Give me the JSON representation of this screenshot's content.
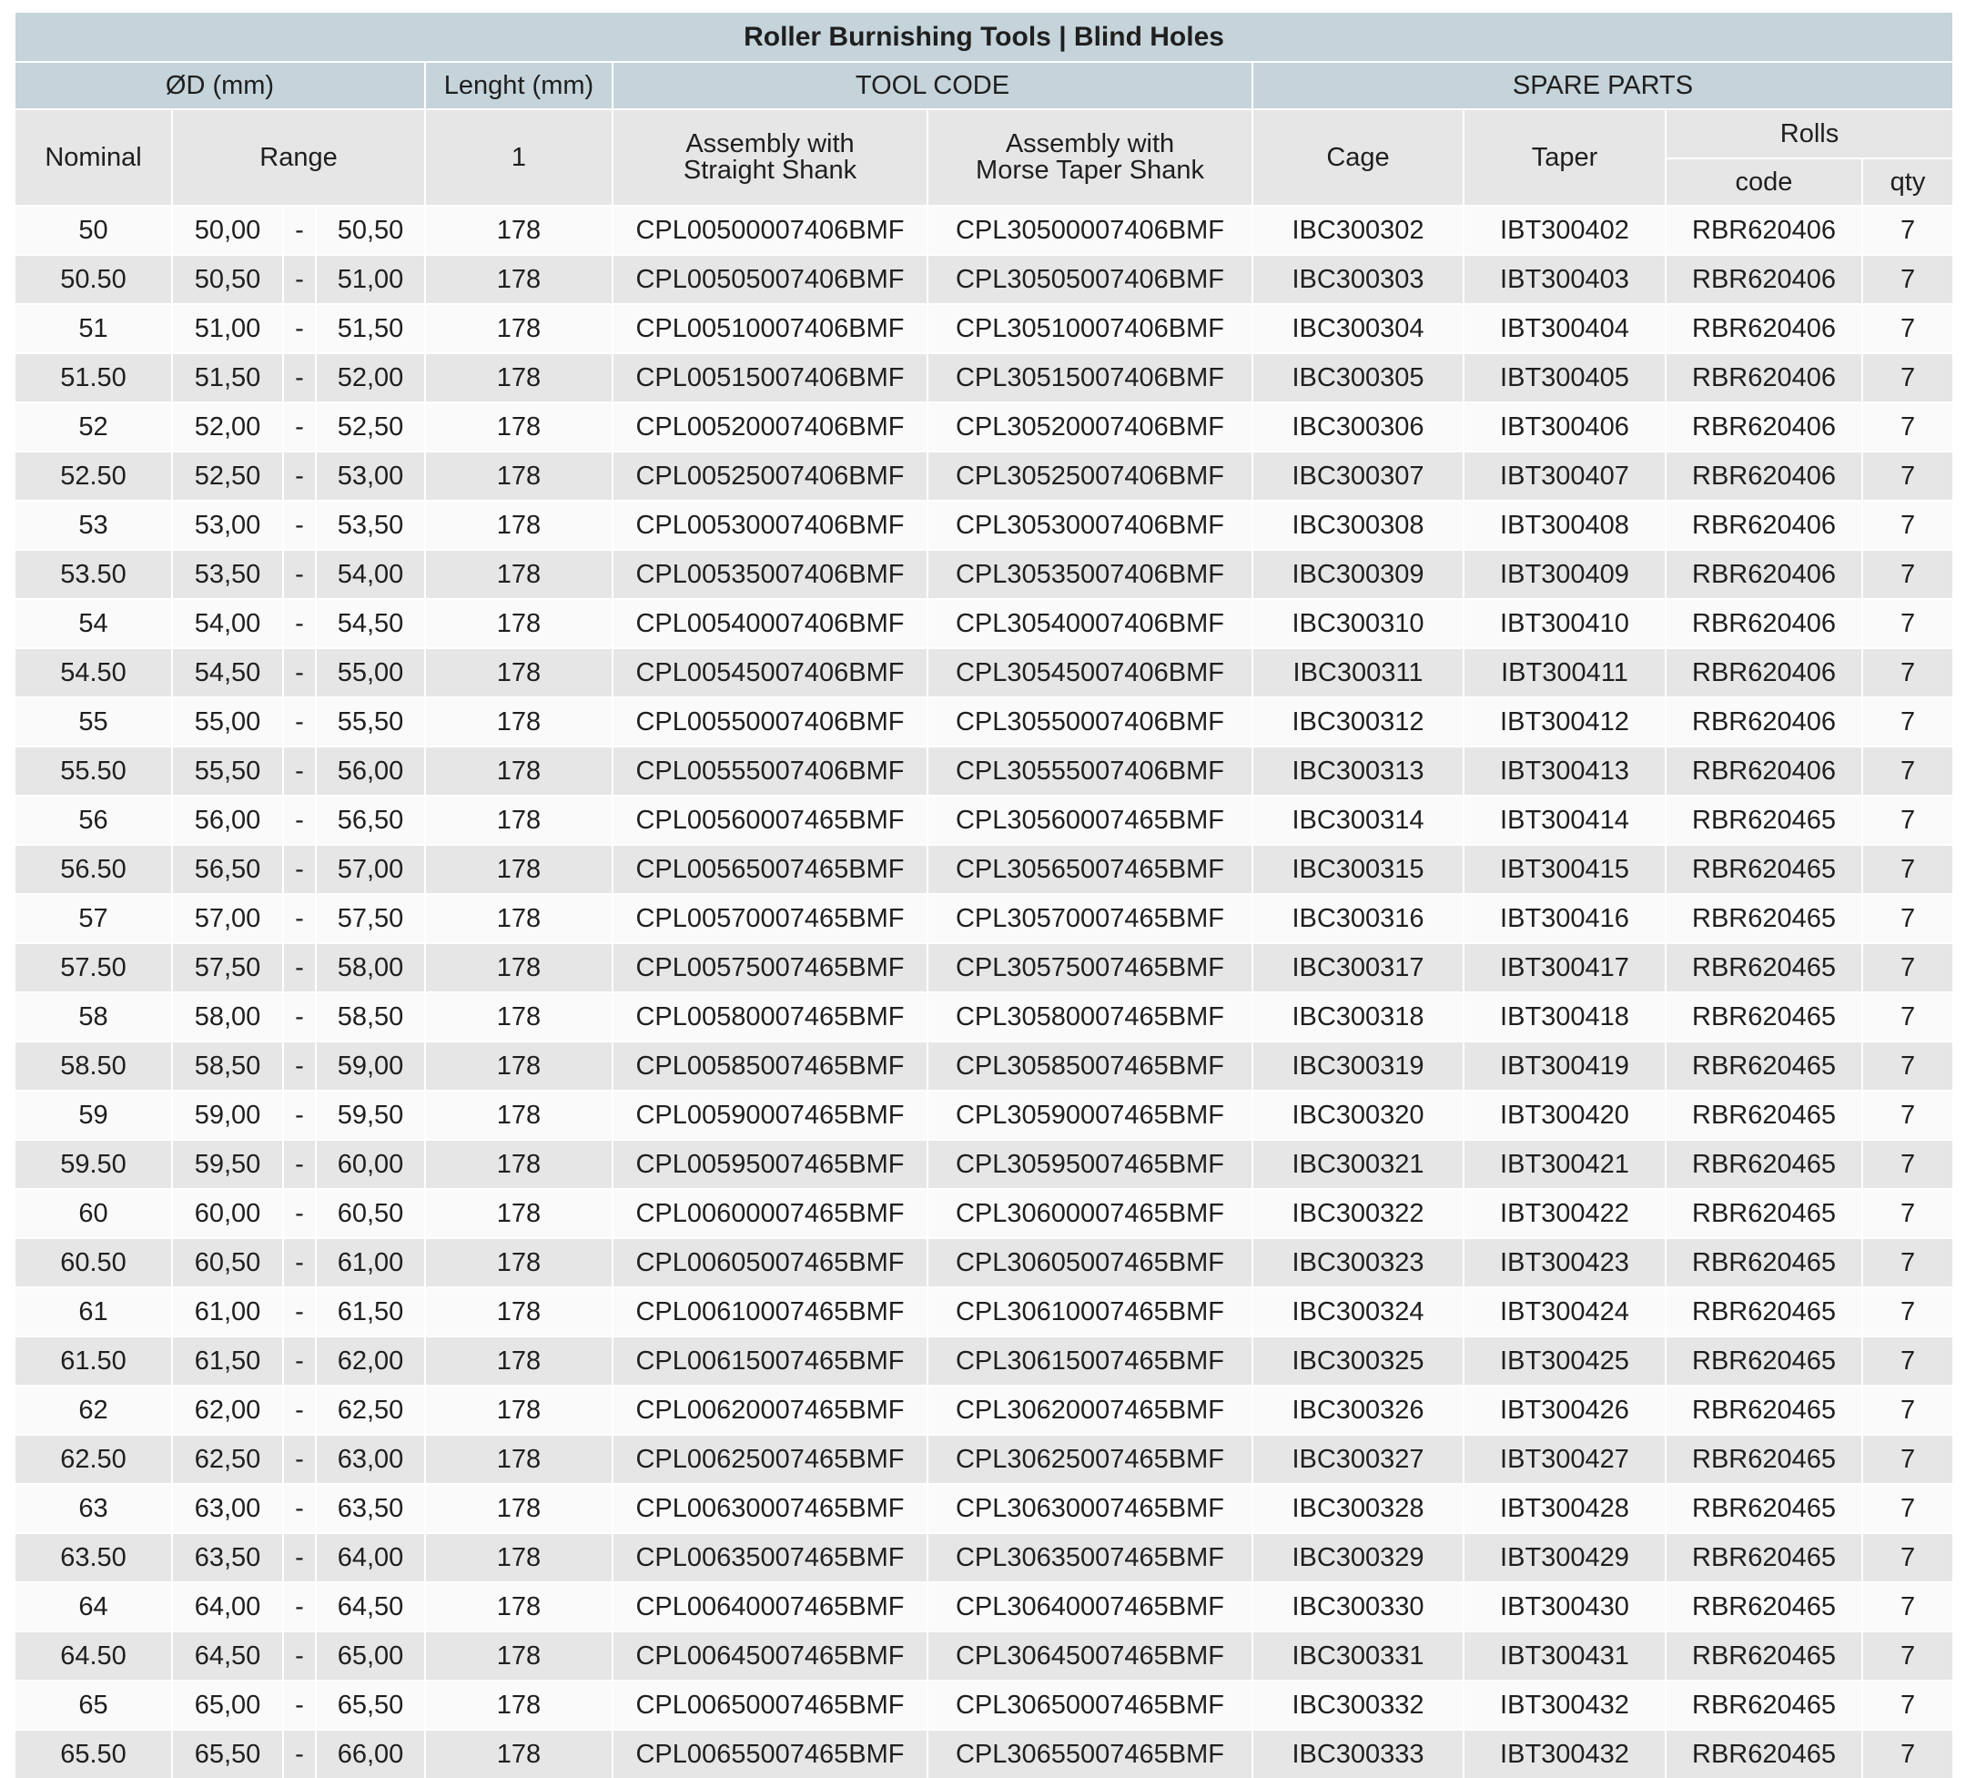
{
  "title": "Roller Burnishing Tools | Blind Holes",
  "groups": {
    "diameter": "ØD (mm)",
    "length": "Lenght (mm)",
    "tool_code": "TOOL CODE",
    "spare_parts": "SPARE PARTS"
  },
  "headers": {
    "nominal": "Nominal",
    "range": "Range",
    "length_sub": "1",
    "straight_1": "Assembly with",
    "straight_2": "Straight Shank",
    "morse_1": "Assembly with",
    "morse_2": "Morse Taper Shank",
    "cage": "Cage",
    "taper": "Taper",
    "rolls": "Rolls",
    "rolls_code": "code",
    "rolls_qty": "qty"
  },
  "range_separator": "-",
  "rows": [
    {
      "nominal": "50",
      "min": "50,00",
      "max": "50,50",
      "length": "178",
      "straight": "CPL00500007406BMF",
      "morse": "CPL30500007406BMF",
      "cage": "IBC300302",
      "taper": "IBT300402",
      "roll_code": "RBR620406",
      "qty": "7"
    },
    {
      "nominal": "50.50",
      "min": "50,50",
      "max": "51,00",
      "length": "178",
      "straight": "CPL00505007406BMF",
      "morse": "CPL30505007406BMF",
      "cage": "IBC300303",
      "taper": "IBT300403",
      "roll_code": "RBR620406",
      "qty": "7"
    },
    {
      "nominal": "51",
      "min": "51,00",
      "max": "51,50",
      "length": "178",
      "straight": "CPL00510007406BMF",
      "morse": "CPL30510007406BMF",
      "cage": "IBC300304",
      "taper": "IBT300404",
      "roll_code": "RBR620406",
      "qty": "7"
    },
    {
      "nominal": "51.50",
      "min": "51,50",
      "max": "52,00",
      "length": "178",
      "straight": "CPL00515007406BMF",
      "morse": "CPL30515007406BMF",
      "cage": "IBC300305",
      "taper": "IBT300405",
      "roll_code": "RBR620406",
      "qty": "7"
    },
    {
      "nominal": "52",
      "min": "52,00",
      "max": "52,50",
      "length": "178",
      "straight": "CPL00520007406BMF",
      "morse": "CPL30520007406BMF",
      "cage": "IBC300306",
      "taper": "IBT300406",
      "roll_code": "RBR620406",
      "qty": "7"
    },
    {
      "nominal": "52.50",
      "min": "52,50",
      "max": "53,00",
      "length": "178",
      "straight": "CPL00525007406BMF",
      "morse": "CPL30525007406BMF",
      "cage": "IBC300307",
      "taper": "IBT300407",
      "roll_code": "RBR620406",
      "qty": "7"
    },
    {
      "nominal": "53",
      "min": "53,00",
      "max": "53,50",
      "length": "178",
      "straight": "CPL00530007406BMF",
      "morse": "CPL30530007406BMF",
      "cage": "IBC300308",
      "taper": "IBT300408",
      "roll_code": "RBR620406",
      "qty": "7"
    },
    {
      "nominal": "53.50",
      "min": "53,50",
      "max": "54,00",
      "length": "178",
      "straight": "CPL00535007406BMF",
      "morse": "CPL30535007406BMF",
      "cage": "IBC300309",
      "taper": "IBT300409",
      "roll_code": "RBR620406",
      "qty": "7"
    },
    {
      "nominal": "54",
      "min": "54,00",
      "max": "54,50",
      "length": "178",
      "straight": "CPL00540007406BMF",
      "morse": "CPL30540007406BMF",
      "cage": "IBC300310",
      "taper": "IBT300410",
      "roll_code": "RBR620406",
      "qty": "7"
    },
    {
      "nominal": "54.50",
      "min": "54,50",
      "max": "55,00",
      "length": "178",
      "straight": "CPL00545007406BMF",
      "morse": "CPL30545007406BMF",
      "cage": "IBC300311",
      "taper": "IBT300411",
      "roll_code": "RBR620406",
      "qty": "7"
    },
    {
      "nominal": "55",
      "min": "55,00",
      "max": "55,50",
      "length": "178",
      "straight": "CPL00550007406BMF",
      "morse": "CPL30550007406BMF",
      "cage": "IBC300312",
      "taper": "IBT300412",
      "roll_code": "RBR620406",
      "qty": "7"
    },
    {
      "nominal": "55.50",
      "min": "55,50",
      "max": "56,00",
      "length": "178",
      "straight": "CPL00555007406BMF",
      "morse": "CPL30555007406BMF",
      "cage": "IBC300313",
      "taper": "IBT300413",
      "roll_code": "RBR620406",
      "qty": "7"
    },
    {
      "nominal": "56",
      "min": "56,00",
      "max": "56,50",
      "length": "178",
      "straight": "CPL00560007465BMF",
      "morse": "CPL30560007465BMF",
      "cage": "IBC300314",
      "taper": "IBT300414",
      "roll_code": "RBR620465",
      "qty": "7"
    },
    {
      "nominal": "56.50",
      "min": "56,50",
      "max": "57,00",
      "length": "178",
      "straight": "CPL00565007465BMF",
      "morse": "CPL30565007465BMF",
      "cage": "IBC300315",
      "taper": "IBT300415",
      "roll_code": "RBR620465",
      "qty": "7"
    },
    {
      "nominal": "57",
      "min": "57,00",
      "max": "57,50",
      "length": "178",
      "straight": "CPL00570007465BMF",
      "morse": "CPL30570007465BMF",
      "cage": "IBC300316",
      "taper": "IBT300416",
      "roll_code": "RBR620465",
      "qty": "7"
    },
    {
      "nominal": "57.50",
      "min": "57,50",
      "max": "58,00",
      "length": "178",
      "straight": "CPL00575007465BMF",
      "morse": "CPL30575007465BMF",
      "cage": "IBC300317",
      "taper": "IBT300417",
      "roll_code": "RBR620465",
      "qty": "7"
    },
    {
      "nominal": "58",
      "min": "58,00",
      "max": "58,50",
      "length": "178",
      "straight": "CPL00580007465BMF",
      "morse": "CPL30580007465BMF",
      "cage": "IBC300318",
      "taper": "IBT300418",
      "roll_code": "RBR620465",
      "qty": "7"
    },
    {
      "nominal": "58.50",
      "min": "58,50",
      "max": "59,00",
      "length": "178",
      "straight": "CPL00585007465BMF",
      "morse": "CPL30585007465BMF",
      "cage": "IBC300319",
      "taper": "IBT300419",
      "roll_code": "RBR620465",
      "qty": "7"
    },
    {
      "nominal": "59",
      "min": "59,00",
      "max": "59,50",
      "length": "178",
      "straight": "CPL00590007465BMF",
      "morse": "CPL30590007465BMF",
      "cage": "IBC300320",
      "taper": "IBT300420",
      "roll_code": "RBR620465",
      "qty": "7"
    },
    {
      "nominal": "59.50",
      "min": "59,50",
      "max": "60,00",
      "length": "178",
      "straight": "CPL00595007465BMF",
      "morse": "CPL30595007465BMF",
      "cage": "IBC300321",
      "taper": "IBT300421",
      "roll_code": "RBR620465",
      "qty": "7"
    },
    {
      "nominal": "60",
      "min": "60,00",
      "max": "60,50",
      "length": "178",
      "straight": "CPL00600007465BMF",
      "morse": "CPL30600007465BMF",
      "cage": "IBC300322",
      "taper": "IBT300422",
      "roll_code": "RBR620465",
      "qty": "7"
    },
    {
      "nominal": "60.50",
      "min": "60,50",
      "max": "61,00",
      "length": "178",
      "straight": "CPL00605007465BMF",
      "morse": "CPL30605007465BMF",
      "cage": "IBC300323",
      "taper": "IBT300423",
      "roll_code": "RBR620465",
      "qty": "7"
    },
    {
      "nominal": "61",
      "min": "61,00",
      "max": "61,50",
      "length": "178",
      "straight": "CPL00610007465BMF",
      "morse": "CPL30610007465BMF",
      "cage": "IBC300324",
      "taper": "IBT300424",
      "roll_code": "RBR620465",
      "qty": "7"
    },
    {
      "nominal": "61.50",
      "min": "61,50",
      "max": "62,00",
      "length": "178",
      "straight": "CPL00615007465BMF",
      "morse": "CPL30615007465BMF",
      "cage": "IBC300325",
      "taper": "IBT300425",
      "roll_code": "RBR620465",
      "qty": "7"
    },
    {
      "nominal": "62",
      "min": "62,00",
      "max": "62,50",
      "length": "178",
      "straight": "CPL00620007465BMF",
      "morse": "CPL30620007465BMF",
      "cage": "IBC300326",
      "taper": "IBT300426",
      "roll_code": "RBR620465",
      "qty": "7"
    },
    {
      "nominal": "62.50",
      "min": "62,50",
      "max": "63,00",
      "length": "178",
      "straight": "CPL00625007465BMF",
      "morse": "CPL30625007465BMF",
      "cage": "IBC300327",
      "taper": "IBT300427",
      "roll_code": "RBR620465",
      "qty": "7"
    },
    {
      "nominal": "63",
      "min": "63,00",
      "max": "63,50",
      "length": "178",
      "straight": "CPL00630007465BMF",
      "morse": "CPL30630007465BMF",
      "cage": "IBC300328",
      "taper": "IBT300428",
      "roll_code": "RBR620465",
      "qty": "7"
    },
    {
      "nominal": "63.50",
      "min": "63,50",
      "max": "64,00",
      "length": "178",
      "straight": "CPL00635007465BMF",
      "morse": "CPL30635007465BMF",
      "cage": "IBC300329",
      "taper": "IBT300429",
      "roll_code": "RBR620465",
      "qty": "7"
    },
    {
      "nominal": "64",
      "min": "64,00",
      "max": "64,50",
      "length": "178",
      "straight": "CPL00640007465BMF",
      "morse": "CPL30640007465BMF",
      "cage": "IBC300330",
      "taper": "IBT300430",
      "roll_code": "RBR620465",
      "qty": "7"
    },
    {
      "nominal": "64.50",
      "min": "64,50",
      "max": "65,00",
      "length": "178",
      "straight": "CPL00645007465BMF",
      "morse": "CPL30645007465BMF",
      "cage": "IBC300331",
      "taper": "IBT300431",
      "roll_code": "RBR620465",
      "qty": "7"
    },
    {
      "nominal": "65",
      "min": "65,00",
      "max": "65,50",
      "length": "178",
      "straight": "CPL00650007465BMF",
      "morse": "CPL30650007465BMF",
      "cage": "IBC300332",
      "taper": "IBT300432",
      "roll_code": "RBR620465",
      "qty": "7"
    },
    {
      "nominal": "65.50",
      "min": "65,50",
      "max": "66,00",
      "length": "178",
      "straight": "CPL00655007465BMF",
      "morse": "CPL30655007465BMF",
      "cage": "IBC300333",
      "taper": "IBT300432",
      "roll_code": "RBR620465",
      "qty": "7"
    }
  ]
}
